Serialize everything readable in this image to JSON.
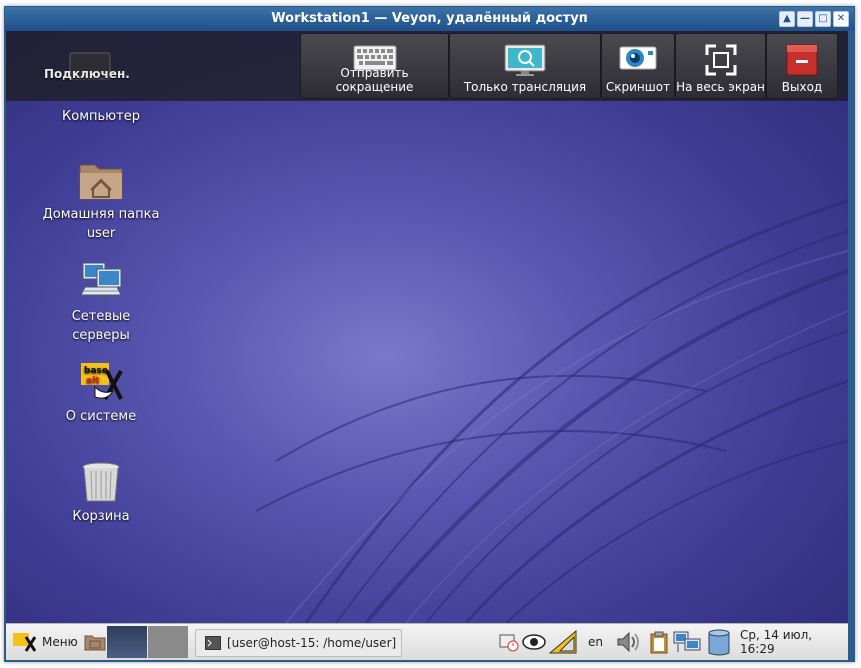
{
  "window": {
    "title": "Workstation1 — Veyon, удалённый доступ",
    "controls": [
      "restore-up",
      "minimize",
      "maximize",
      "close"
    ]
  },
  "toolbar": {
    "status": "Подключен.",
    "buttons": [
      {
        "label": "Отправить сокращение",
        "icon": "keyboard-icon"
      },
      {
        "label": "Только трансляция",
        "icon": "monitor-view-only-icon"
      },
      {
        "label": "Скриншот",
        "icon": "camera-icon"
      },
      {
        "label": "На весь экран",
        "icon": "fullscreen-icon"
      },
      {
        "label": "Выход",
        "icon": "exit-icon"
      }
    ]
  },
  "desktop": {
    "icons": [
      {
        "label": "Компьютер",
        "icon": "computer-icon"
      },
      {
        "label": "Домашняя папка",
        "label2": "user",
        "icon": "home-folder-icon"
      },
      {
        "label": "Сетевые серверы",
        "icon": "network-servers-icon"
      },
      {
        "label": "О системе",
        "icon": "base-alt-logo-icon"
      },
      {
        "label": "Корзина",
        "icon": "trash-icon"
      }
    ]
  },
  "taskbar": {
    "menu_label": "Меню",
    "task": "[user@host-15: /home/user]",
    "keyboard_layout": "en",
    "clock": "Ср, 14 июл, 16:29"
  },
  "colors": {
    "titlebar": "#2a5c8c",
    "desktop": "#4a47a2",
    "toolbar": "#2a2a32",
    "taskbar": "#e6e6e6",
    "accent_red": "#c8302c"
  }
}
